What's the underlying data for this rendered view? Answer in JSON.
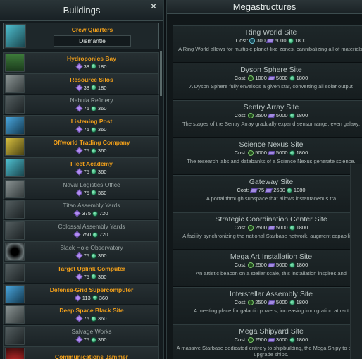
{
  "left": {
    "title": "Buildings",
    "close_glyph": "✕",
    "crew_quarters": {
      "name": "Crew Quarters",
      "dismantle_label": "Dismantle"
    },
    "items": [
      {
        "name": "Hydroponics Bay",
        "alloys": "38",
        "energy": "180",
        "state": "avail",
        "thumb": "t-green"
      },
      {
        "name": "Resource Silos",
        "alloys": "38",
        "energy": "180",
        "state": "avail",
        "thumb": "t-grey"
      },
      {
        "name": "Nebula Refinery",
        "alloys": "75",
        "energy": "360",
        "state": "locked",
        "thumb": "t-dark"
      },
      {
        "name": "Listening Post",
        "alloys": "75",
        "energy": "360",
        "state": "avail",
        "thumb": "t-blue"
      },
      {
        "name": "Offworld Trading Company",
        "alloys": "75",
        "energy": "360",
        "state": "avail",
        "thumb": "t-yellow"
      },
      {
        "name": "Fleet Academy",
        "alloys": "75",
        "energy": "360",
        "state": "avail",
        "thumb": "t-teal"
      },
      {
        "name": "Naval Logistics Office",
        "alloys": "75",
        "energy": "360",
        "state": "locked",
        "thumb": "t-grey"
      },
      {
        "name": "Titan Assembly Yards",
        "alloys": "375",
        "energy": "720",
        "state": "locked",
        "thumb": "t-dark"
      },
      {
        "name": "Colossal Assembly Yards",
        "alloys": "750",
        "energy": "720",
        "state": "locked",
        "thumb": "t-dark"
      },
      {
        "name": "Black Hole Observatory",
        "alloys": "75",
        "energy": "360",
        "state": "locked",
        "thumb": "t-bh"
      },
      {
        "name": "Target Uplink Computer",
        "alloys": "75",
        "energy": "360",
        "state": "avail",
        "thumb": "t-dark"
      },
      {
        "name": "Defense-Grid Supercomputer",
        "alloys": "113",
        "energy": "360",
        "state": "avail",
        "thumb": "t-blue"
      },
      {
        "name": "Deep Space Black Site",
        "alloys": "75",
        "energy": "360",
        "state": "avail",
        "thumb": "t-grey"
      },
      {
        "name": "Salvage Works",
        "alloys": "75",
        "energy": "360",
        "state": "locked",
        "thumb": "t-dark"
      },
      {
        "name": "Communications Jammer",
        "alloys": "",
        "energy": "",
        "state": "avail",
        "thumb": "t-red"
      }
    ]
  },
  "right": {
    "title": "Megastructures",
    "cost_label": "Cost:",
    "items": [
      {
        "name": "Ring World Site",
        "c1": "300",
        "c2": "5000",
        "c3": "1800",
        "c1_icon": "influence",
        "desc": "A Ring World allows for multiple planet-like zones, cannibalizing all of materials."
      },
      {
        "name": "Dyson Sphere Site",
        "c1": "1000",
        "c2": "5000",
        "c3": "1800",
        "c1_icon": "unity",
        "desc": "A Dyson Sphere fully envelops a given star, converting all solar output"
      },
      {
        "name": "Sentry Array Site",
        "c1": "2500",
        "c2": "5000",
        "c3": "1800",
        "c1_icon": "unity",
        "desc": "The stages of the Sentry Array gradually expand sensor range, even galaxy."
      },
      {
        "name": "Science Nexus Site",
        "c1": "5000",
        "c2": "5000",
        "c3": "1800",
        "c1_icon": "unity",
        "desc": "The research labs and databanks of a Science Nexus generate science."
      },
      {
        "name": "Gateway Site",
        "c1": "75",
        "c2": "2500",
        "c3": "1080",
        "c1_icon": "alloy",
        "desc": "A portal through subspace that allows instantaneous tra"
      },
      {
        "name": "Strategic Coordination Center Site",
        "c1": "2500",
        "c2": "5000",
        "c3": "1800",
        "c1_icon": "unity",
        "desc": "A facility synchronizing the national Starbase network, augment capabilities."
      },
      {
        "name": "Mega Art Installation Site",
        "c1": "2500",
        "c2": "5000",
        "c3": "1800",
        "c1_icon": "unity",
        "desc": "An artistic beacon on a stellar scale, this installation inspires and"
      },
      {
        "name": "Interstellar Assembly Site",
        "c1": "2500",
        "c2": "5000",
        "c3": "1800",
        "c1_icon": "unity",
        "desc": "A meeting place for galactic powers, increasing immigration attract"
      },
      {
        "name": "Mega Shipyard Site",
        "c1": "2500",
        "c2": "3000",
        "c3": "1800",
        "c1_icon": "unity",
        "desc": "A massive Starbase dedicated entirely to shipbuilding, the Mega Shipy to build or upgrade ships."
      }
    ]
  },
  "colors": {
    "accent": "#f2a01a",
    "locked": "#9ba6a5",
    "energy": "#3ecb8a",
    "alloy": "#b18cf0"
  }
}
